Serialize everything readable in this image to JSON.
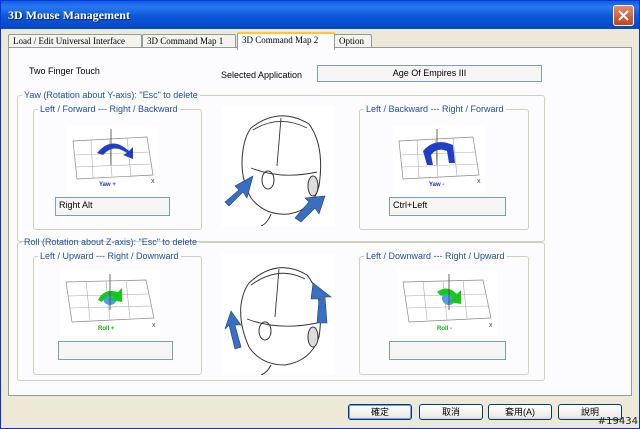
{
  "window": {
    "title": "3D Mouse Management"
  },
  "tabs": [
    {
      "label": "Load / Edit Universal Interface",
      "active": false
    },
    {
      "label": "3D Command Map 1",
      "active": false
    },
    {
      "label": "3D Command Map 2",
      "active": true
    },
    {
      "label": "Option",
      "active": false
    }
  ],
  "header": {
    "gesture_label": "Two Finger Touch",
    "app_label": "Selected Application",
    "app_value": "Age Of Empires III"
  },
  "yaw": {
    "group_label": "Yaw (Rotation about Y-axis): \"Esc\" to delete",
    "left": {
      "label": "Left / Forward --- Right / Backward",
      "caption": "Yaw +",
      "value": "Right Alt"
    },
    "right": {
      "label": "Left / Backward --- Right / Forward",
      "caption": "Yaw -",
      "value": "Ctrl+Left"
    }
  },
  "roll": {
    "group_label": "Roll (Rotation about Z-axis): \"Esc\" to delete",
    "left": {
      "label": "Left / Upward --- Right / Downward",
      "caption": "Roll +",
      "value": ""
    },
    "right": {
      "label": "Left / Downward --- Right / Upward",
      "caption": "Roll -",
      "value": ""
    }
  },
  "buttons": {
    "ok": "確定",
    "cancel": "取消",
    "apply": "套用(A)",
    "help": "說明"
  },
  "watermark": "#19434",
  "colors": {
    "yaw_arrow": "#1f3fc8",
    "roll_arrow": "#18c818",
    "legend": "#1f4fa8",
    "caption_yaw": "#2030c0",
    "caption_roll": "#10b010"
  }
}
